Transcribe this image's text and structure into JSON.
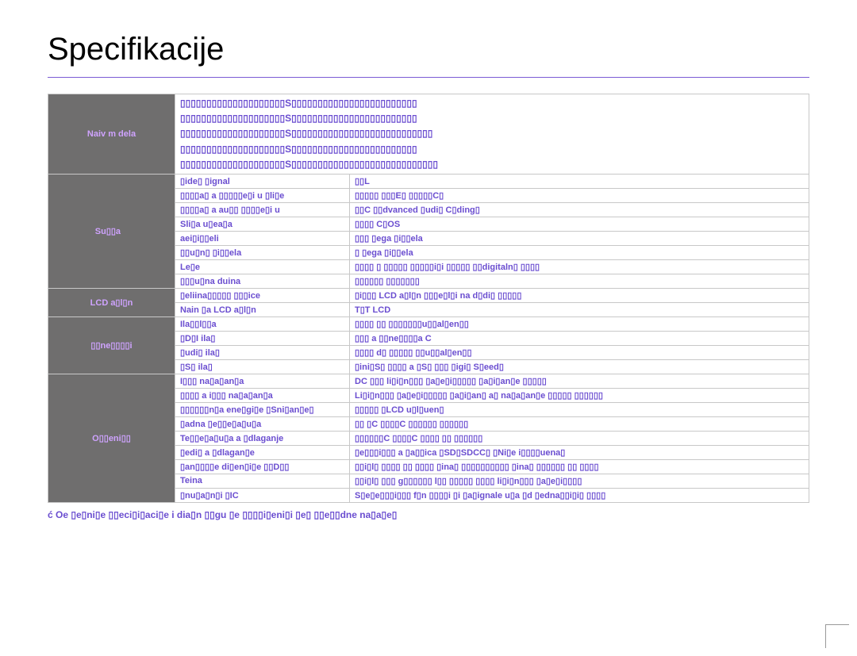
{
  "title": "Specifikacije",
  "models_section": {
    "label": "Naiv m dela",
    "lines": [
      "▯▯▯▯▯▯▯▯▯▯▯▯▯▯▯▯▯▯▯▯S▯▯▯▯▯▯▯▯▯▯▯▯▯▯▯▯▯▯▯▯▯▯▯▯",
      "▯▯▯▯▯▯▯▯▯▯▯▯▯▯▯▯▯▯▯▯S▯▯▯▯▯▯▯▯▯▯▯▯▯▯▯▯▯▯▯▯▯▯▯▯",
      "▯▯▯▯▯▯▯▯▯▯▯▯▯▯▯▯▯▯▯▯S▯▯▯▯▯▯▯▯▯▯▯▯▯▯▯▯▯▯▯▯▯▯▯▯▯▯▯",
      "▯▯▯▯▯▯▯▯▯▯▯▯▯▯▯▯▯▯▯▯S▯▯▯▯▯▯▯▯▯▯▯▯▯▯▯▯▯▯▯▯▯▯▯▯",
      "▯▯▯▯▯▯▯▯▯▯▯▯▯▯▯▯▯▯▯▯S▯▯▯▯▯▯▯▯▯▯▯▯▯▯▯▯▯▯▯▯▯▯▯▯▯▯▯▯"
    ]
  },
  "sections": [
    {
      "label": "Su▯▯a   ",
      "rows": [
        {
          "prop": "▯ide▯ ▯ignal",
          "val": "▯▯L"
        },
        {
          "prop": "▯▯▯▯a▯ a ▯▯▯▯▯e▯i u ▯li▯e",
          "val": "▯▯▯▯▯ ▯▯▯E▯ ▯▯▯▯▯C▯"
        },
        {
          "prop": "▯▯▯▯a▯ a au▯▯ ▯▯▯▯e▯i u",
          "val": "▯▯C ▯▯dvanced ▯udi▯ C▯ding▯"
        },
        {
          "prop": "Sli▯a u▯ea▯a",
          "val": "▯▯▯▯ C▯OS"
        },
        {
          "prop": "aei▯i▯▯eli",
          "val": "▯▯▯ ▯ega ▯i▯▯ela"
        },
        {
          "prop": "▯▯u▯n▯ ▯i▯▯ela",
          "val": "▯ ▯ega ▯i▯▯ela"
        },
        {
          "prop": "Le▯e",
          "val": "▯▯▯▯ ▯ ▯▯▯▯▯ ▯▯▯▯▯i▯i ▯▯▯▯▯ ▯▯digitaln▯ ▯▯▯▯"
        },
        {
          "prop": "▯▯▯u▯na duina",
          "val": "▯▯▯▯▯▯ ▯▯▯▯▯▯▯"
        }
      ]
    },
    {
      "label": "LCD a▯l▯n",
      "rows": [
        {
          "prop": "▯eliina▯▯▯▯▯ ▯▯▯ice",
          "val": "▯i▯▯▯ LCD a▯l▯n ▯▯▯e▯l▯i na d▯di▯ ▯▯▯▯▯"
        },
        {
          "prop": "Nain ▯a LCD a▯l▯n",
          "val": "T▯T LCD"
        }
      ]
    },
    {
      "label": "▯▯ne▯▯▯▯i",
      "rows": [
        {
          "prop": "Ila▯▯l▯▯a",
          "val": "▯▯▯▯ ▯▯ ▯▯▯▯▯▯▯u▯▯al▯en▯▯"
        },
        {
          "prop": "▯D▯I ila▯",
          "val": "▯▯▯ a ▯▯ne▯▯▯▯a C"
        },
        {
          "prop": "▯udi▯ ila▯",
          "val": "▯▯▯▯ d▯ ▯▯▯▯▯ ▯▯u▯▯al▯en▯▯"
        },
        {
          "prop": "▯S▯ ila▯",
          "val": "▯ini▯S▯ ▯▯▯▯ a ▯S▯ ▯▯▯ ▯igi▯ S▯eed▯"
        }
      ]
    },
    {
      "label": "O▯▯eni▯▯",
      "rows": [
        {
          "prop": "I▯▯▯ na▯a▯an▯a",
          "val": "DC ▯▯▯ li▯i▯n▯▯▯ ▯a▯e▯i▯▯▯▯▯ ▯a▯i▯an▯e ▯▯▯▯▯"
        },
        {
          "prop": "▯▯▯▯ a i▯▯▯ na▯a▯an▯a",
          "val": "Li▯i▯n▯▯▯ ▯a▯e▯i▯▯▯▯▯ ▯a▯i▯an▯ a▯ na▯a▯an▯e ▯▯▯▯▯ ▯▯▯▯▯▯"
        },
        {
          "prop": "▯▯▯▯▯▯n▯a ene▯gi▯e ▯Sni▯an▯e▯",
          "val": "▯▯▯▯▯ ▯LCD u▯l▯uen▯"
        },
        {
          "prop": "▯adna ▯e▯▯e▯a▯u▯a",
          "val": "▯▯ ▯C ▯▯▯▯C ▯▯▯▯▯▯ ▯▯▯▯▯▯"
        },
        {
          "prop": "Te▯▯e▯a▯u▯a a ▯dlaganje",
          "val": "▯▯▯▯▯▯C ▯▯▯▯C ▯▯▯▯ ▯▯ ▯▯▯▯▯▯"
        },
        {
          "prop": "▯edi▯ a ▯dlagan▯e",
          "val": "▯e▯▯▯i▯▯▯ a ▯a▯▯ica ▯SD▯SDCC▯ ▯Ni▯e i▯▯▯▯uena▯"
        },
        {
          "prop": "▯an▯▯▯▯e di▯en▯i▯e ▯▯D▯▯",
          "val": "▯▯i▯l▯ ▯▯▯▯ ▯▯ ▯▯▯▯ ▯ina▯ ▯▯▯▯▯▯▯▯▯▯ ▯ina▯ ▯▯▯▯▯▯ ▯▯ ▯▯▯▯"
        },
        {
          "prop": "Teina",
          "val": "▯▯i▯l▯ ▯▯▯ g▯▯▯▯▯▯ l▯▯ ▯▯▯▯▯ ▯▯▯▯ li▯i▯n▯▯▯ ▯a▯e▯i▯▯▯▯"
        },
        {
          "prop": "▯nu▯a▯n▯i ▯IC",
          "val": "S▯e▯e▯▯▯i▯▯▯ f▯n ▯▯▯▯i ▯i ▯a▯ignale u▯a ▯d ▯edna▯▯i▯i▯ ▯▯▯▯"
        }
      ]
    }
  ],
  "footnote": "ć Oe ▯e▯ni▯e ▯▯eci▯i▯aci▯e i dia▯n ▯▯gu ▯e ▯▯▯▯i▯eni▯i ▯e▯ ▯▯e▯▯dne na▯a▯e▯"
}
